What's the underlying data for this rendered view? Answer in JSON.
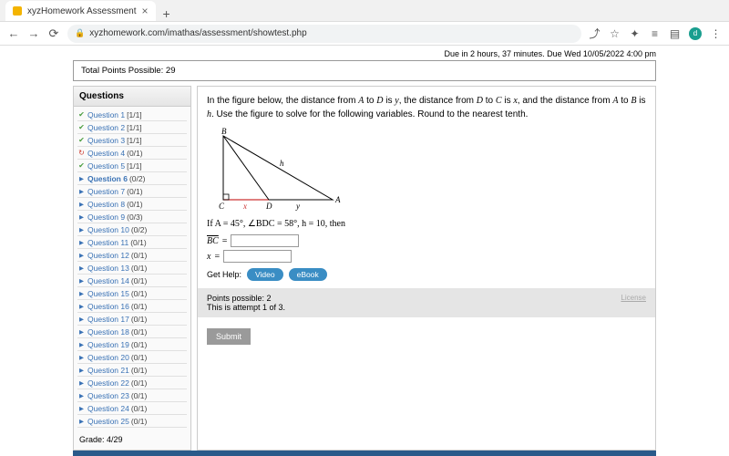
{
  "browser": {
    "tab_title": "xyzHomework Assessment",
    "url": "xyzhomework.com/imathas/assessment/showtest.php"
  },
  "header": {
    "due_text": "Due in 2 hours, 37 minutes. Due Wed 10/05/2022 4:00 pm",
    "points_possible": "Total Points Possible: 29"
  },
  "sidebar": {
    "title": "Questions",
    "grade": "Grade: 4/29",
    "items": [
      {
        "icon": "check",
        "label": "Question 1",
        "score": "[1/1]"
      },
      {
        "icon": "check",
        "label": "Question 2",
        "score": "[1/1]"
      },
      {
        "icon": "check",
        "label": "Question 3",
        "score": "[1/1]"
      },
      {
        "icon": "redo",
        "label": "Question 4",
        "score": "(0/1)"
      },
      {
        "icon": "check",
        "label": "Question 5",
        "score": "[1/1]"
      },
      {
        "icon": "play",
        "label": "Question 6",
        "score": "(0/2)",
        "current": true
      },
      {
        "icon": "play",
        "label": "Question 7",
        "score": "(0/1)"
      },
      {
        "icon": "play",
        "label": "Question 8",
        "score": "(0/1)"
      },
      {
        "icon": "play",
        "label": "Question 9",
        "score": "(0/3)"
      },
      {
        "icon": "play",
        "label": "Question 10",
        "score": "(0/2)"
      },
      {
        "icon": "play",
        "label": "Question 11",
        "score": "(0/1)"
      },
      {
        "icon": "play",
        "label": "Question 12",
        "score": "(0/1)"
      },
      {
        "icon": "play",
        "label": "Question 13",
        "score": "(0/1)"
      },
      {
        "icon": "play",
        "label": "Question 14",
        "score": "(0/1)"
      },
      {
        "icon": "play",
        "label": "Question 15",
        "score": "(0/1)"
      },
      {
        "icon": "play",
        "label": "Question 16",
        "score": "(0/1)"
      },
      {
        "icon": "play",
        "label": "Question 17",
        "score": "(0/1)"
      },
      {
        "icon": "play",
        "label": "Question 18",
        "score": "(0/1)"
      },
      {
        "icon": "play",
        "label": "Question 19",
        "score": "(0/1)"
      },
      {
        "icon": "play",
        "label": "Question 20",
        "score": "(0/1)"
      },
      {
        "icon": "play",
        "label": "Question 21",
        "score": "(0/1)"
      },
      {
        "icon": "play",
        "label": "Question 22",
        "score": "(0/1)"
      },
      {
        "icon": "play",
        "label": "Question 23",
        "score": "(0/1)"
      },
      {
        "icon": "play",
        "label": "Question 24",
        "score": "(0/1)"
      },
      {
        "icon": "play",
        "label": "Question 25",
        "score": "(0/1)"
      }
    ]
  },
  "problem": {
    "text_parts": [
      "In the figure below, the distance from ",
      "A",
      " to ",
      "D",
      " is ",
      "y",
      ", the distance from ",
      "D",
      " to ",
      "C",
      " is ",
      "x",
      ", and the distance from ",
      "A",
      " to ",
      "B",
      " is ",
      "h",
      ". Use the figure to solve for the following variables. Round to the nearest tenth."
    ],
    "labels": {
      "B": "B",
      "C": "C",
      "D": "D",
      "A": "A",
      "x": "x",
      "y": "y",
      "h": "h"
    },
    "given": "If A = 45°, ∠BDC = 58°, h = 10, then",
    "eq1_lhs": "BC",
    "eq2_lhs": "x",
    "equals": "=",
    "help_label": "Get Help:",
    "video": "Video",
    "ebook": "eBook",
    "points": "Points possible: 2",
    "attempt": "This is attempt 1 of 3.",
    "license": "License",
    "submit": "Submit"
  }
}
